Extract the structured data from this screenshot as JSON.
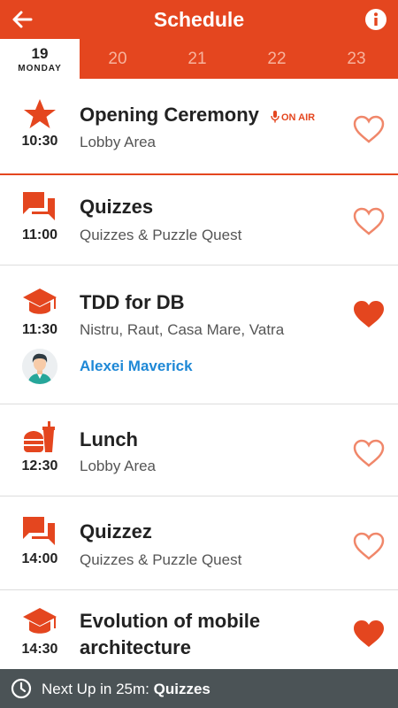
{
  "header": {
    "title": "Schedule",
    "back_icon": "arrow-left-icon",
    "info_icon": "info-icon",
    "color": "#e4461f"
  },
  "days": [
    {
      "number": "19",
      "name": "MONDAY",
      "active": true
    },
    {
      "number": "20"
    },
    {
      "number": "21"
    },
    {
      "number": "22"
    },
    {
      "number": "23"
    }
  ],
  "sessions": [
    {
      "title": "Opening Ceremony",
      "location": "Lobby Area",
      "time": "10:30",
      "icon": "star-icon",
      "badge": "ON AIR",
      "favorite": false
    },
    {
      "title": "Quizzes",
      "location": "Quizzes & Puzzle Quest",
      "time": "11:00",
      "icon": "chat-icon",
      "favorite": false
    },
    {
      "title": "TDD for DB",
      "location": "Nistru, Raut, Casa Mare, Vatra",
      "time": "11:30",
      "icon": "graduation-cap-icon",
      "speaker": "Alexei Maverick",
      "favorite": true
    },
    {
      "title": "Lunch",
      "location": "Lobby Area",
      "time": "12:30",
      "icon": "fast-food-icon",
      "favorite": false
    },
    {
      "title": "Quizzez",
      "location": "Quizzes & Puzzle Quest",
      "time": "14:00",
      "icon": "chat-icon",
      "favorite": false
    },
    {
      "title": "Evolution of mobile",
      "title_line2": "architecture",
      "time": "14:30",
      "icon": "graduation-cap-icon",
      "favorite": true
    }
  ],
  "footer": {
    "prefix": "Next Up in 25m: ",
    "next": "Quizzes",
    "icon": "clock-icon"
  }
}
